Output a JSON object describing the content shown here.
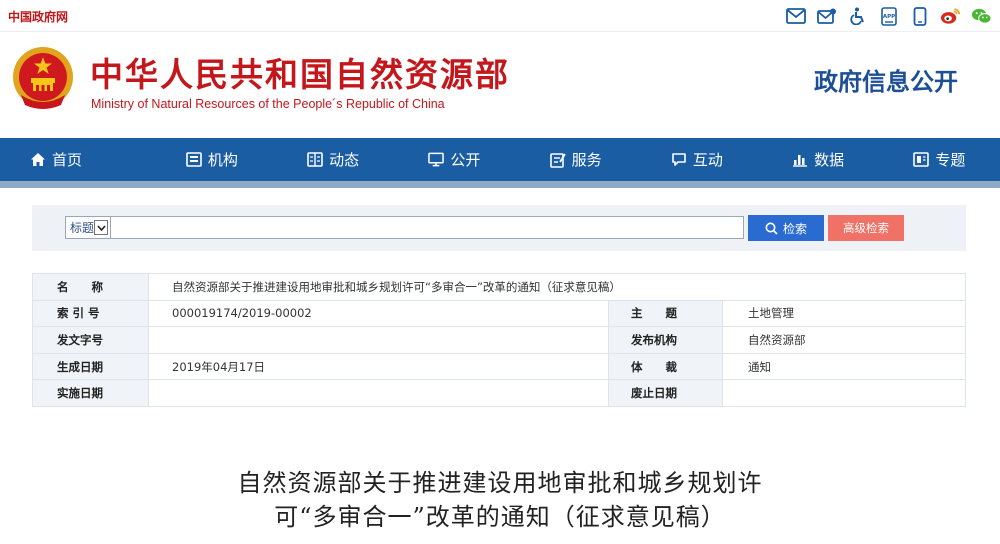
{
  "topbar": {
    "gov_link": "中国政府网",
    "icons": [
      "mail-icon",
      "subscribe-mail-icon",
      "accessibility-icon",
      "app-icon",
      "mobile-icon",
      "weibo-icon",
      "wechat-icon"
    ]
  },
  "header": {
    "site_name_cn": "中华人民共和国自然资源部",
    "site_name_en": "Ministry of Natural Resources of the People´s Republic of China",
    "gov_info": "政府信息公开"
  },
  "nav": {
    "items": [
      {
        "label": "首页",
        "icon": "home-icon"
      },
      {
        "label": "机构",
        "icon": "institution-icon"
      },
      {
        "label": "动态",
        "icon": "news-icon"
      },
      {
        "label": "公开",
        "icon": "disclosure-icon"
      },
      {
        "label": "服务",
        "icon": "service-icon"
      },
      {
        "label": "互动",
        "icon": "interaction-icon"
      },
      {
        "label": "数据",
        "icon": "data-icon"
      },
      {
        "label": "专题",
        "icon": "topic-icon"
      }
    ]
  },
  "search": {
    "field_selected": "标题",
    "query": "",
    "search_label": "检索",
    "advanced_label": "高级检索"
  },
  "meta": {
    "name_label": "名　　称",
    "name_value": "自然资源部关于推进建设用地审批和城乡规划许可“多审合一”改革的通知（征求意见稿）",
    "index_label": "索 引 号",
    "index_value": "000019174/2019-00002",
    "subject_label": "主　　题",
    "subject_value": "土地管理",
    "docno_label": "发文字号",
    "docno_value": "",
    "issuer_label": "发布机构",
    "issuer_value": "自然资源部",
    "created_label": "生成日期",
    "created_value": "2019年04月17日",
    "genre_label": "体　　裁",
    "genre_value": "通知",
    "effective_label": "实施日期",
    "effective_value": "",
    "expiry_label": "废止日期",
    "expiry_value": ""
  },
  "article": {
    "title_line1": "自然资源部关于推进建设用地审批和城乡规划许",
    "title_line2": "可“多审合一”改革的通知（征求意见稿）"
  },
  "colors": {
    "brand_red": "#c3171c",
    "nav_blue": "#1a5da3",
    "gov_info_blue": "#1c4f95",
    "search_blue": "#2a6bd1",
    "advanced_coral": "#f07166"
  }
}
